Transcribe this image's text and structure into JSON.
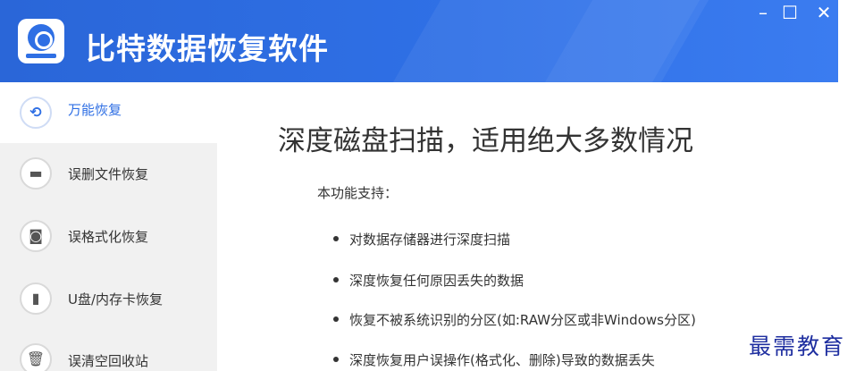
{
  "window": {
    "title": "比特数据恢复软件",
    "controls": {
      "minimize": "–",
      "maximize": "☐",
      "close": "✕"
    }
  },
  "sidebar": {
    "items": [
      {
        "label": "万能恢复",
        "icon": "refresh-icon",
        "glyph": "⟲",
        "active": true
      },
      {
        "label": "误删文件恢复",
        "icon": "folder-icon",
        "glyph": "▬",
        "active": false
      },
      {
        "label": "误格式化恢复",
        "icon": "disk-icon",
        "glyph": "◙",
        "active": false
      },
      {
        "label": "U盘/内存卡恢复",
        "icon": "usb-drive-icon",
        "glyph": "▮",
        "active": false
      },
      {
        "label": "误清空回收站",
        "icon": "trash-icon",
        "glyph": "🗑",
        "active": false
      }
    ]
  },
  "main": {
    "heading": "深度磁盘扫描，适用绝大多数情况",
    "intro": "本功能支持：",
    "features": [
      "对数据存储器进行深度扫描",
      "深度恢复任何原因丢失的数据",
      "恢复不被系统识别的分区(如:RAW分区或非Windows分区)",
      "深度恢复用户误操作(格式化、删除)导致的数据丢失"
    ]
  },
  "watermark": "最需教育",
  "colors": {
    "accent": "#2f6fe4",
    "titlebar": "#2f70e6",
    "sidebar_bg": "#f1f1f1"
  }
}
